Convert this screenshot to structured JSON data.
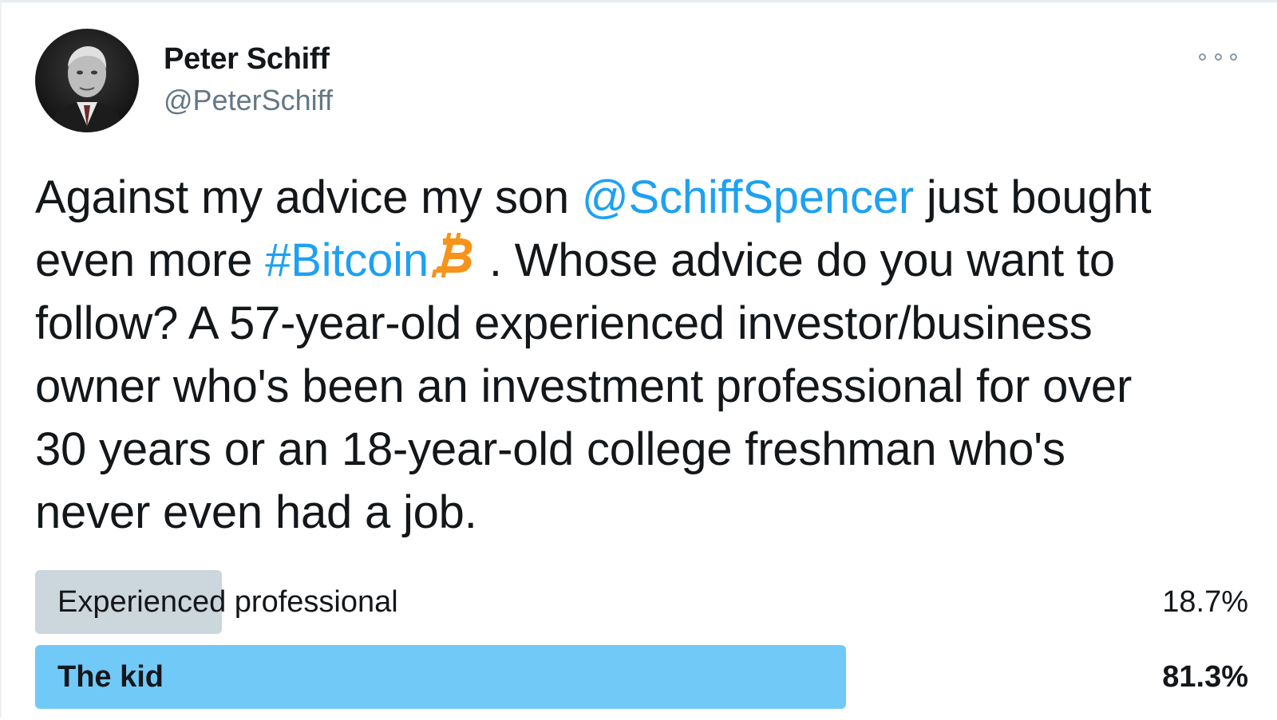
{
  "tweet": {
    "author_name": "Peter Schiff",
    "author_handle": "@PeterSchiff",
    "avatar_icon": "person-portrait-avatar",
    "more_icon": "more-options-icon",
    "text_lines": [
      {
        "before": "Against my advice my son ",
        "mention": "@SchiffSpencer",
        "after": " just bought"
      },
      {
        "before": "even more ",
        "hashtag": "#Bitcoin",
        "icon": "bitcoin-icon",
        "after": " . Whose advice do you want to"
      },
      {
        "text": "follow? A 57-year-old experienced investor/business"
      },
      {
        "text": "owner who's been an investment professional for over"
      },
      {
        "text": "30 years or an 18-year-old college freshman who's"
      },
      {
        "text": "never even had a job."
      }
    ]
  },
  "poll": {
    "options": [
      {
        "label": "Experienced professional",
        "percent_text": "18.7%",
        "percent": 18.7,
        "winner": false,
        "bar_color": "#ccd6dd"
      },
      {
        "label": "The kid",
        "percent_text": "81.3%",
        "percent": 81.3,
        "winner": true,
        "bar_color": "#71c9f8"
      }
    ]
  },
  "colors": {
    "link": "#1da1f2",
    "bitcoin": "#f7931a",
    "muted_text": "#657786"
  }
}
